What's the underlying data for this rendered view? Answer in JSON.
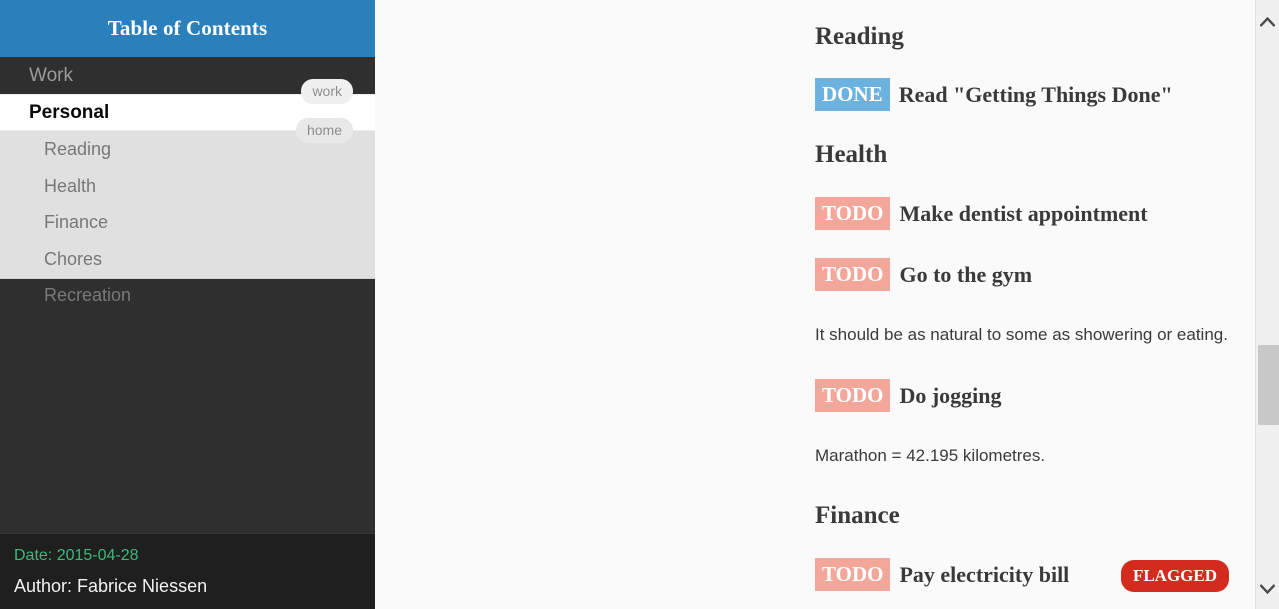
{
  "sidebar": {
    "header_title": "Table of Contents",
    "top_items": [
      {
        "label": "Work",
        "tag": "work",
        "active": false
      },
      {
        "label": "Personal",
        "tag": "home",
        "active": true
      }
    ],
    "sub_items": [
      {
        "label": "Reading"
      },
      {
        "label": "Health"
      },
      {
        "label": "Finance"
      },
      {
        "label": "Chores"
      },
      {
        "label": "Recreation"
      }
    ],
    "footer": {
      "date": "Date: 2015-04-28",
      "author": "Author: Fabrice Niessen"
    }
  },
  "content": {
    "blocks": [
      {
        "kind": "heading",
        "text": "Reading"
      },
      {
        "kind": "task",
        "keyword": "DONE",
        "keyword_type": "done",
        "text": "Read \"Getting Things Done\""
      },
      {
        "kind": "heading",
        "text": "Health"
      },
      {
        "kind": "task",
        "keyword": "TODO",
        "keyword_type": "todo",
        "text": "Make dentist appointment"
      },
      {
        "kind": "task",
        "keyword": "TODO",
        "keyword_type": "todo",
        "text": "Go to the gym"
      },
      {
        "kind": "para",
        "text": "It should be as natural to some as showering or eating."
      },
      {
        "kind": "task",
        "keyword": "TODO",
        "keyword_type": "todo",
        "text": "Do jogging"
      },
      {
        "kind": "para",
        "text": "Marathon = 42.195 kilometres."
      },
      {
        "kind": "heading",
        "text": "Finance"
      },
      {
        "kind": "task",
        "keyword": "TODO",
        "keyword_type": "todo",
        "text": "Pay electricity bill",
        "flag": "FLAGGED"
      }
    ]
  },
  "scrollbar": {
    "up_icon": "chevron-up-icon",
    "down_icon": "chevron-down-icon"
  },
  "colors": {
    "header_blue": "#2b80bb",
    "sidebar_dark": "#2f2f2f",
    "sidebar_sub_bg": "#e0e0e0",
    "done_badge": "#6cb2e0",
    "todo_badge": "#f3a79a",
    "flagged_badge": "#d32b1e",
    "footer_date_green": "#3cb878",
    "content_bg": "#fafafa"
  }
}
